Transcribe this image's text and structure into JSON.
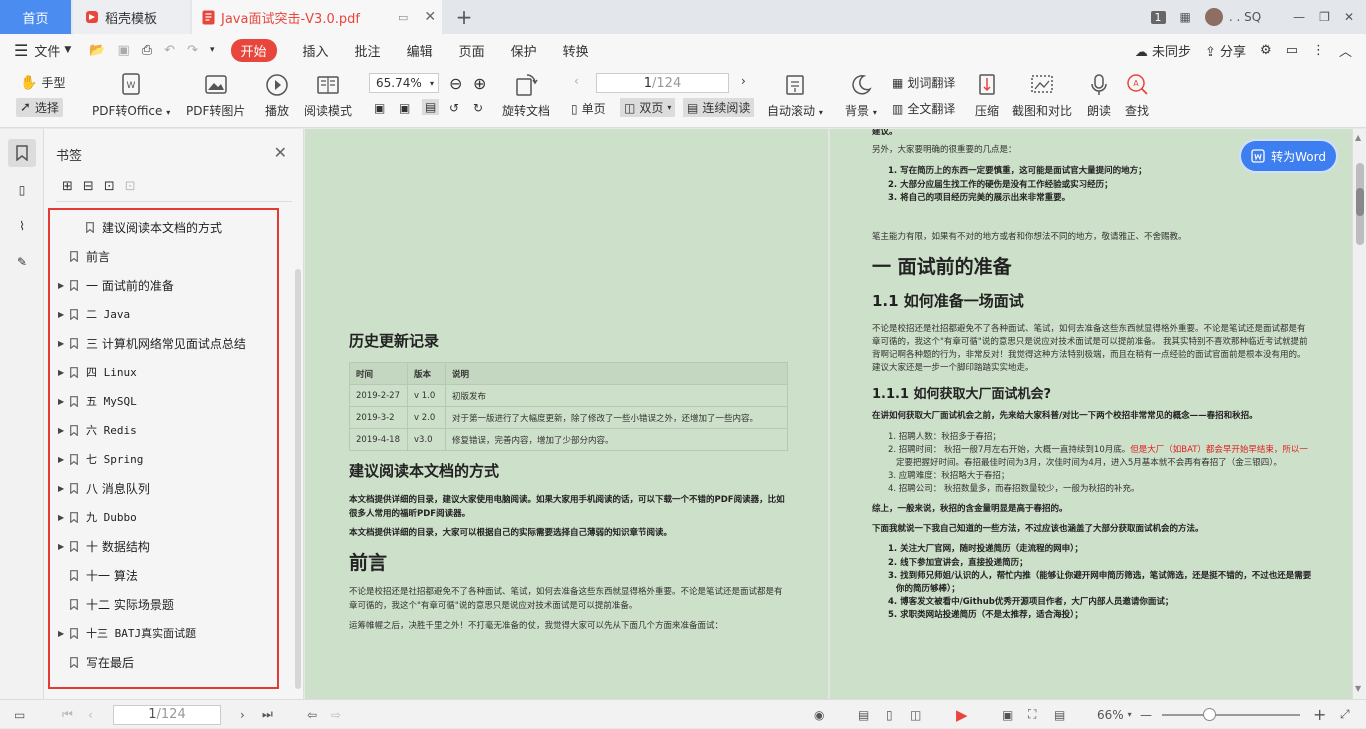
{
  "tabs": {
    "home": "首页",
    "template": "稻壳模板",
    "pdf": "Java面试突击-V3.0.pdf",
    "add": "+"
  },
  "window": {
    "badge": "1",
    "user": ". . SQ"
  },
  "menu": {
    "file": "文件",
    "items": [
      "开始",
      "插入",
      "批注",
      "编辑",
      "页面",
      "保护",
      "转换"
    ],
    "sync": "未同步",
    "share": "分享"
  },
  "toolbar": {
    "hand": "手型",
    "select": "选择",
    "pdf_office": "PDF转Office",
    "pdf_image": "PDF转图片",
    "play": "播放",
    "read_mode": "阅读模式",
    "zoom": "65.74%",
    "rotate": "旋转文档",
    "page_current": "1",
    "page_total": "/124",
    "single": "单页",
    "double": "双页",
    "continuous": "连续阅读",
    "auto_scroll": "自动滚动",
    "background": "背景",
    "word_translate": "划词翻译",
    "full_translate": "全文翻译",
    "compress": "压缩",
    "screenshot": "截图和对比",
    "read_aloud": "朗读",
    "find": "查找"
  },
  "bookmarks": {
    "title": "书签",
    "items": [
      {
        "label": "建议阅读本文档的方式",
        "expandable": false
      },
      {
        "label": "前言",
        "expandable": false
      },
      {
        "label": "一 面试前的准备",
        "expandable": true
      },
      {
        "label": "二 Java",
        "expandable": true
      },
      {
        "label": "三  计算机网络常见面试点总结",
        "expandable": true
      },
      {
        "label": "四 Linux",
        "expandable": true
      },
      {
        "label": "五 MySQL",
        "expandable": true
      },
      {
        "label": "六 Redis",
        "expandable": true
      },
      {
        "label": "七 Spring",
        "expandable": true
      },
      {
        "label": "八 消息队列",
        "expandable": true
      },
      {
        "label": "九 Dubbo",
        "expandable": true
      },
      {
        "label": "十 数据结构",
        "expandable": true
      },
      {
        "label": "十一 算法",
        "expandable": false
      },
      {
        "label": "十二 实际场景题",
        "expandable": false
      },
      {
        "label": "十三 BATJ真实面试题",
        "expandable": true
      },
      {
        "label": "写在最后",
        "expandable": false
      }
    ]
  },
  "left_page": {
    "history_title": "历史更新记录",
    "table_headers": [
      "时间",
      "版本",
      "说明"
    ],
    "table_rows": [
      [
        "2019-2-27",
        "v 1.0",
        "初版发布"
      ],
      [
        "2019-3-2",
        "v 2.0",
        "对于第一版进行了大幅度更新，除了修改了一些小错误之外，还增加了一些内容。"
      ],
      [
        "2019-4-18",
        "v3.0",
        "修复错误，完善内容，增加了少部分内容。"
      ]
    ],
    "how_to_title": "建议阅读本文档的方式",
    "how_to_p1a": "本文档提供详细的目录，建议大家使用电脑阅读。如果大家用手机阅读的话，可以下载一个不错的PDF阅读器，比如",
    "how_to_p1b": "很多人常用的福昕PDF阅读器。",
    "how_to_p2": "本文档提供详细的目录，大家可以根据自己的实际需要选择自己薄弱的知识章节阅读。",
    "preface_title": "前言",
    "preface_p1a": "不论是校招还是社招都避免不了各种面试、笔试，如何去准备这些东西就显得格外重要。不论是笔试还是面试都是有",
    "preface_p1b": "章可循的，我这个\"有章可循\"说的意思只是说应对技术面试是可以提前准备。",
    "preface_p2": "运筹帷幄之后，决胜千里之外！不打毫无准备的仗，我觉得大家可以先从下面几个方面来准备面试："
  },
  "right_page": {
    "top_cut": "建议。",
    "intro": "另外，大家要明确的很重要的几点是：",
    "points": [
      "1. 写在简历上的东西一定要慎重，这可能是面试官大量提问的地方；",
      "2. 大部分应届生找工作的硬伤是没有工作经验或实习经历；",
      "3. 将自己的项目经历完美的展示出来非常重要。"
    ],
    "note": "笔主能力有限，如果有不对的地方或者和你想法不同的地方，敬请雅正、不舍赐教。",
    "h_prep": "一 面试前的准备",
    "h_11": "1.1 如何准备一场面试",
    "p11a": "不论是校招还是社招都避免不了各种面试、笔试，如何去准备这些东西就显得格外重要。不论是笔试还是面试都是有",
    "p11b": "章可循的，我这个\"有章可循\"说的意思只是说应对技术面试是可以提前准备。 我其实特别不喜欢那种临近考试就提前",
    "p11c": "背啊记啊各种题的行为，非常反对！我觉得这种方法特别极端，而且在稍有一点经验的面试官面前是根本没有用的。",
    "p11d": "建议大家还是一步一个脚印踏踏实实地走。",
    "h_111": "1.1.1 如何获取大厂面试机会?",
    "p111": "在讲如何获取大厂面试机会之前，先来给大家科普/对比一下两个校招非常常见的概念——春招和秋招。",
    "list_a": [
      "1. 招聘人数：秋招多于春招；",
      "2. 招聘时间： 秋招一般7月左右开始，大概一直持续到10月底。",
      "定要把握好时间。春招最佳时间为3月，次佳时间为4月，进入5月基本就不会再有春招了（金三银四）。",
      "3. 应聘难度：秋招略大于春招；",
      "4. 招聘公司： 秋招数量多，而春招数量较少，一般为秋招的补充。"
    ],
    "red_text": "但是大厂（如BAT）都会早开始早结束，所以一",
    "summary": "综上，一般来说，秋招的含金量明显是高于春招的。",
    "methods_intro": "下面我就说一下我自己知道的一些方法，不过应该也涵盖了大部分获取面试机会的方法。",
    "list_b": [
      "1. 关注大厂官网，随时投递简历（走流程的网申）；",
      "2. 线下参加宣讲会，直接投递简历；",
      "3. 找到师兄师姐/认识的人，帮忙内推（能够让你避开网申简历筛选，笔试筛选，还是挺不错的，不过也还是需要",
      "你的简历够棒）；",
      "4. 博客发文被看中/Github优秀开源项目作者，大厂内部人员邀请你面试；",
      "5. 求职类网站投递简历（不是太推荐，适合海投）；"
    ],
    "convert_word": "转为Word"
  },
  "status": {
    "page_current": "1",
    "page_total": "/124",
    "zoom": "66%"
  }
}
